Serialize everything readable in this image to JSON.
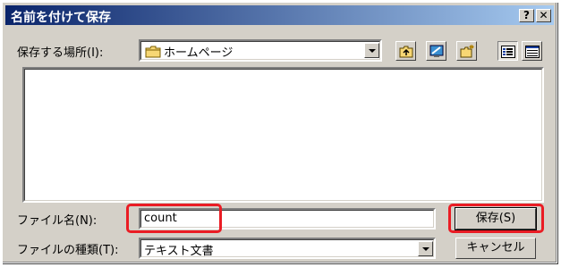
{
  "window": {
    "title": "名前を付けて保存",
    "help_glyph": "?",
    "close_glyph": "✕"
  },
  "location": {
    "label": "保存する場所(I):",
    "folder": "ホームページ",
    "folder_icon": "folder-icon"
  },
  "toolbar": {
    "icons": [
      "up-folder-icon",
      "desktop-icon",
      "new-folder-icon",
      "list-view-icon",
      "details-view-icon"
    ]
  },
  "filename": {
    "label": "ファイル名(N):",
    "value": "count"
  },
  "filetype": {
    "label": "ファイルの種類(T):",
    "value": "テキスト文書"
  },
  "buttons": {
    "save": "保存(S)",
    "cancel": "キャンセル"
  },
  "colors": {
    "highlight": "#ea1c24",
    "titlebar_start": "#0a246a",
    "titlebar_end": "#a6caf0",
    "face": "#d4d0c8"
  }
}
